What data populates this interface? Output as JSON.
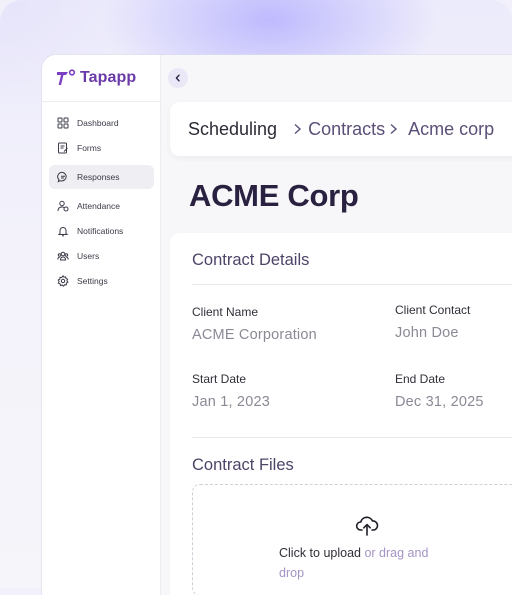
{
  "brand": {
    "name": "Tapapp",
    "accent": "#6a3aa8"
  },
  "sidebar": {
    "items": [
      {
        "label": "Dashboard",
        "icon": "dashboard-icon"
      },
      {
        "label": "Forms",
        "icon": "forms-icon"
      },
      {
        "label": "Responses",
        "icon": "responses-icon",
        "active": true
      },
      {
        "label": "Attendance",
        "icon": "attendance-icon"
      },
      {
        "label": "Notifications",
        "icon": "bell-icon"
      },
      {
        "label": "Users",
        "icon": "users-icon"
      },
      {
        "label": "Settings",
        "icon": "gear-icon"
      }
    ]
  },
  "breadcrumb": {
    "items": [
      "Scheduling",
      "Contracts",
      "Acme corp"
    ]
  },
  "page": {
    "title": "ACME Corp"
  },
  "contract_details": {
    "title": "Contract Details",
    "client_name": {
      "label": "Client Name",
      "value": "ACME Corporation"
    },
    "client_contact": {
      "label": "Client Contact",
      "value": "John Doe"
    },
    "start_date": {
      "label": "Start Date",
      "value": "Jan 1, 2023"
    },
    "end_date": {
      "label": "End Date",
      "value": "Dec 31, 2025"
    }
  },
  "contract_files": {
    "title": "Contract Files",
    "upload_action": "Click to upload",
    "upload_hint_1": " or drag and",
    "upload_hint_2": "drop"
  }
}
